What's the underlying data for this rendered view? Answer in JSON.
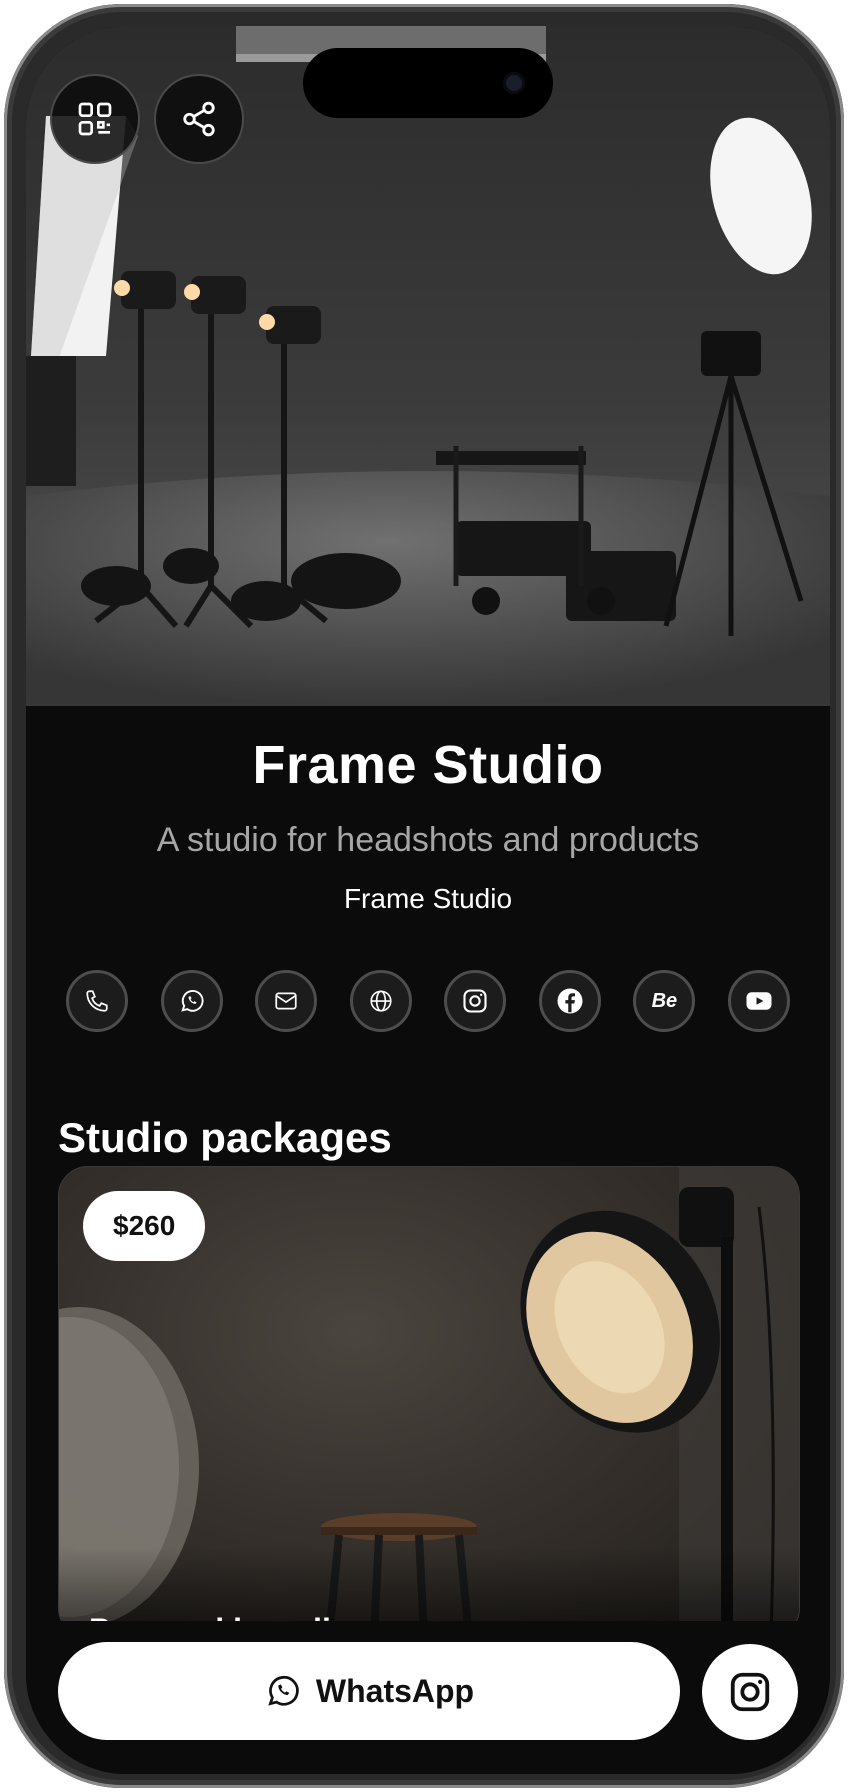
{
  "profile": {
    "name": "Frame Studio",
    "tagline": "A studio for headshots and products",
    "company": "Frame Studio"
  },
  "top_actions": [
    {
      "icon": "qr-code-icon"
    },
    {
      "icon": "share-icon"
    }
  ],
  "socials": [
    {
      "icon": "phone-icon"
    },
    {
      "icon": "whatsapp-icon"
    },
    {
      "icon": "mail-icon"
    },
    {
      "icon": "globe-icon"
    },
    {
      "icon": "instagram-icon"
    },
    {
      "icon": "facebook-icon"
    },
    {
      "icon": "behance-icon",
      "glyph": "Be"
    },
    {
      "icon": "youtube-icon"
    }
  ],
  "packages": {
    "title": "Studio packages",
    "items": [
      {
        "price": "$260",
        "title": "Personal branding"
      }
    ]
  },
  "bottom_bar": {
    "whatsapp_label": "WhatsApp",
    "instagram_icon": "instagram-icon"
  },
  "colors": {
    "background": "#0b0b0b",
    "text": "#ffffff",
    "muted": "#a6a6a6",
    "button_bg": "#ffffff"
  }
}
